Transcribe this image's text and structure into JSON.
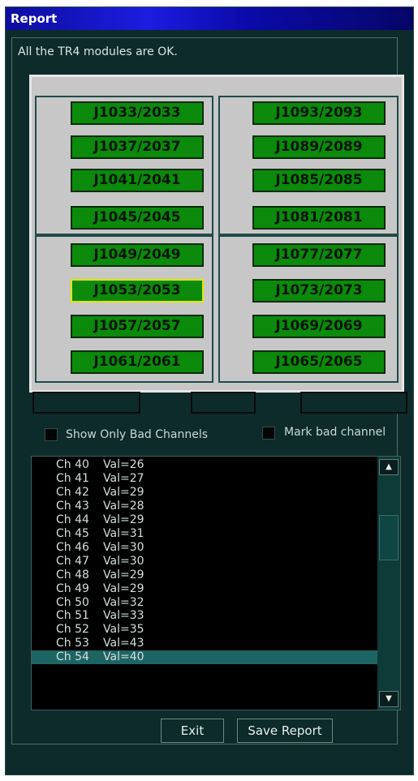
{
  "window": {
    "title": "Report"
  },
  "status": {
    "message": "All the TR4 modules are OK."
  },
  "modules": {
    "top_left": [
      "J1033/2033",
      "J1037/2037",
      "J1041/2041",
      "J1045/2045"
    ],
    "top_right": [
      "J1093/2093",
      "J1089/2089",
      "J1085/2085",
      "J1081/2081"
    ],
    "bottom_left": [
      "J1049/2049",
      "J1053/2053",
      "J1057/2057",
      "J1061/2061"
    ],
    "bottom_right": [
      "J1077/2077",
      "J1073/2073",
      "J1069/2069",
      "J1065/2065"
    ],
    "selected": "J1053/2053",
    "ok_color": "#0b8a0b",
    "selected_border_color": "#e4e400"
  },
  "options": {
    "show_only_bad_label": "Show Only Bad Channels",
    "mark_bad_label": "Mark bad channel"
  },
  "channels": {
    "rows": [
      {
        "ch": "Ch 40",
        "val": "Val=26"
      },
      {
        "ch": "Ch 41",
        "val": "Val=27"
      },
      {
        "ch": "Ch 42",
        "val": "Val=29"
      },
      {
        "ch": "Ch 43",
        "val": "Val=28"
      },
      {
        "ch": "Ch 44",
        "val": "Val=29"
      },
      {
        "ch": "Ch 45",
        "val": "Val=31"
      },
      {
        "ch": "Ch 46",
        "val": "Val=30"
      },
      {
        "ch": "Ch 47",
        "val": "Val=30"
      },
      {
        "ch": "Ch 48",
        "val": "Val=29"
      },
      {
        "ch": "Ch 49",
        "val": "Val=29"
      },
      {
        "ch": "Ch 50",
        "val": "Val=32"
      },
      {
        "ch": "Ch 51",
        "val": "Val=33"
      },
      {
        "ch": "Ch 52",
        "val": "Val=35"
      },
      {
        "ch": "Ch 53",
        "val": "Val=43"
      },
      {
        "ch": "Ch 54",
        "val": "Val=40"
      }
    ],
    "selected": "Ch 54",
    "scroll_up_icon": "arrow-up-icon",
    "scroll_down_icon": "arrow-down-icon"
  },
  "buttons": {
    "exit_label": "Exit",
    "save_label": "Save Report"
  }
}
